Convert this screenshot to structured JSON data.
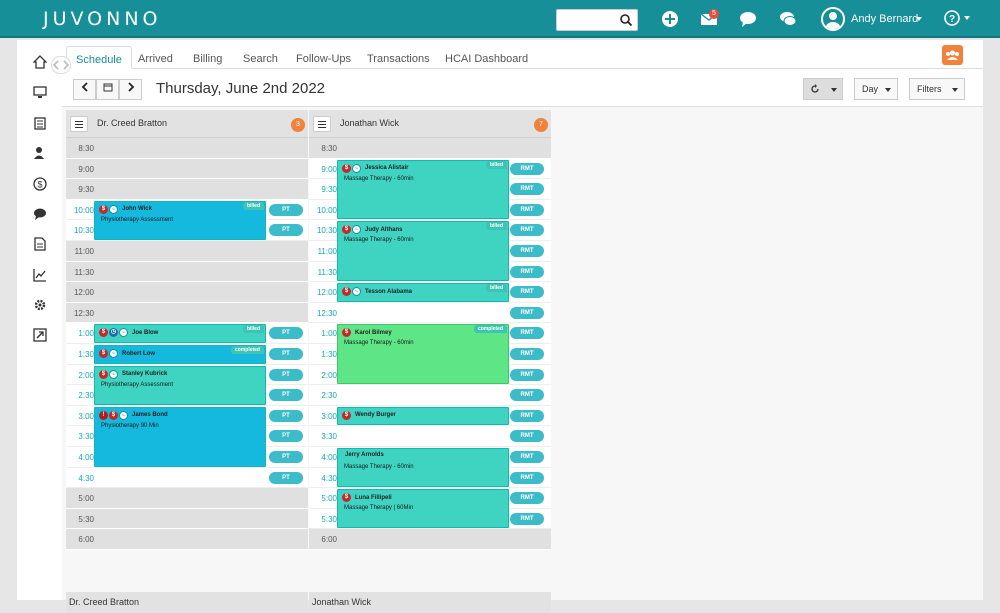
{
  "brand": {
    "logo": "JUVONNO"
  },
  "topbar": {
    "search_placeholder": "",
    "messages_badge": "5",
    "user_name": "Andy Bernard",
    "help": "?"
  },
  "tabs": [
    "Schedule",
    "Arrived",
    "Billing",
    "Search",
    "Follow-Ups",
    "Transactions",
    "HCAI Dashboard"
  ],
  "toolbar": {
    "date": "Thursday, June 2nd 2022",
    "view": "Day",
    "filters": "Filters"
  },
  "columns": [
    {
      "name": "Dr. Creed Bratton",
      "count": "3",
      "footer": "Dr. Creed Bratton",
      "slots": [
        {
          "time": "8:30",
          "avail": false
        },
        {
          "time": "9:00",
          "avail": false
        },
        {
          "time": "9:30",
          "avail": false
        },
        {
          "time": "10:00",
          "avail": true,
          "pill": "PT"
        },
        {
          "time": "10:30",
          "avail": true,
          "pill": "PT"
        },
        {
          "time": "11:00",
          "avail": false
        },
        {
          "time": "11:30",
          "avail": false
        },
        {
          "time": "12:00",
          "avail": false
        },
        {
          "time": "12:30",
          "avail": false
        },
        {
          "time": "1:00",
          "avail": true,
          "pill": "PT"
        },
        {
          "time": "1:30",
          "avail": true,
          "pill": "PT"
        },
        {
          "time": "2:00",
          "avail": true,
          "pill": "PT"
        },
        {
          "time": "2:30",
          "avail": true,
          "pill": "PT"
        },
        {
          "time": "3:00",
          "avail": true,
          "pill": "PT"
        },
        {
          "time": "3:30",
          "avail": true,
          "pill": "PT"
        },
        {
          "time": "4:00",
          "avail": true,
          "pill": "PT"
        },
        {
          "time": "4:30",
          "avail": true,
          "pill": "PT"
        },
        {
          "time": "5:00",
          "avail": false
        },
        {
          "time": "5:30",
          "avail": false
        },
        {
          "time": "6:00",
          "avail": false
        }
      ],
      "appointments": [
        {
          "name": "John Wick",
          "desc": "Physiotherapy Assessment",
          "status": "billed",
          "color": "blue",
          "icons": [
            "s",
            "r"
          ]
        },
        {
          "name": "Joe Blow",
          "desc": "",
          "status": "billed",
          "color": "teal",
          "icons": [
            "s",
            "clk",
            "r"
          ]
        },
        {
          "name": "Robert Low",
          "desc": "",
          "status": "completed",
          "color": "blue",
          "icons": [
            "s",
            "r"
          ]
        },
        {
          "name": "Stanley Kubrick",
          "desc": "Physiotherapy Assessment",
          "status": "",
          "color": "teal",
          "icons": [
            "s",
            "r"
          ]
        },
        {
          "name": "James Bond",
          "desc": "Physiotherapy 90 Min",
          "status": "",
          "color": "blue",
          "icons": [
            "ex",
            "s",
            "r"
          ]
        }
      ]
    },
    {
      "name": "Jonathan Wick",
      "count": "7",
      "footer": "Jonathan Wick",
      "slots": [
        {
          "time": "8:30",
          "avail": false
        },
        {
          "time": "9:00",
          "avail": true,
          "pill": "RMT"
        },
        {
          "time": "9:30",
          "avail": true,
          "pill": "RMT"
        },
        {
          "time": "10:00",
          "avail": true,
          "pill": "RMT"
        },
        {
          "time": "10:30",
          "avail": true,
          "pill": "RMT"
        },
        {
          "time": "11:00",
          "avail": true,
          "pill": "RMT"
        },
        {
          "time": "11:30",
          "avail": true,
          "pill": "RMT"
        },
        {
          "time": "12:00",
          "avail": true,
          "pill": "RMT"
        },
        {
          "time": "12:30",
          "avail": true,
          "pill": "RMT"
        },
        {
          "time": "1:00",
          "avail": true,
          "pill": "RMT"
        },
        {
          "time": "1:30",
          "avail": true,
          "pill": "RMT"
        },
        {
          "time": "2:00",
          "avail": true,
          "pill": "RMT"
        },
        {
          "time": "2:30",
          "avail": true,
          "pill": "RMT"
        },
        {
          "time": "3:00",
          "avail": true,
          "pill": "RMT"
        },
        {
          "time": "3:30",
          "avail": true,
          "pill": "RMT"
        },
        {
          "time": "4:00",
          "avail": true,
          "pill": "RMT"
        },
        {
          "time": "4:30",
          "avail": true,
          "pill": "RMT"
        },
        {
          "time": "5:00",
          "avail": true,
          "pill": "RMT"
        },
        {
          "time": "5:30",
          "avail": true,
          "pill": "RMT"
        },
        {
          "time": "6:00",
          "avail": false
        }
      ],
      "appointments": [
        {
          "name": "Jessica Alistair",
          "desc": "Massage Therapy - 60min",
          "status": "billed",
          "color": "teal",
          "icons": [
            "s",
            "r"
          ]
        },
        {
          "name": "Judy Althans",
          "desc": "Massage Therapy - 60min",
          "status": "billed",
          "color": "teal",
          "icons": [
            "s",
            "r"
          ]
        },
        {
          "name": "Tesson Alabama",
          "desc": "",
          "status": "billed",
          "color": "teal",
          "icons": [
            "s",
            "r"
          ]
        },
        {
          "name": "Karol Bilmey",
          "desc": "Massage Therapy - 60min",
          "status": "completed",
          "color": "green",
          "icons": [
            "s"
          ]
        },
        {
          "name": "Wendy Burger",
          "desc": "",
          "status": "",
          "color": "teal",
          "icons": [
            "s"
          ]
        },
        {
          "name": "Jerry Arnolds",
          "desc": "Massage Therapy - 60min",
          "status": "",
          "color": "teal",
          "icons": []
        },
        {
          "name": "Luna Fillipeli",
          "desc": "Massage Therapy | 60Min",
          "status": "",
          "color": "teal",
          "icons": [
            "s"
          ]
        }
      ]
    }
  ],
  "colors": {
    "brand": "#168f99",
    "accent_orange": "#f0823b",
    "pill": "#3cbcc9",
    "appt_teal": "#3fd3c2",
    "appt_blue": "#14b9dd",
    "appt_green": "#5ee586"
  }
}
